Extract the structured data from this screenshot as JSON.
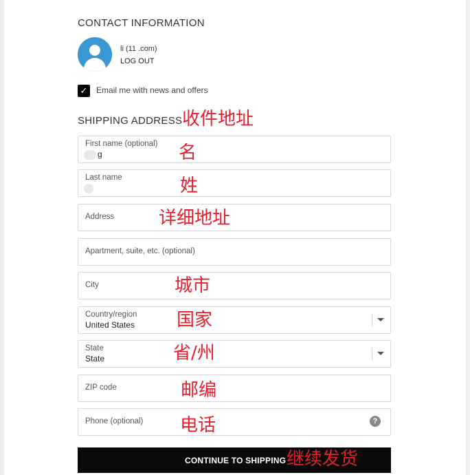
{
  "contact": {
    "title": "CONTACT INFORMATION",
    "user_email": "li (11 .com)",
    "logout_label": "LOG OUT",
    "newsletter_checked": true,
    "newsletter_label": "Email me with news and offers"
  },
  "shipping": {
    "title": "SHIPPING ADDRESS",
    "annotation": "收件地址",
    "fields": {
      "first_name": {
        "label": "First name (optional)",
        "value": "g",
        "annotation": "名"
      },
      "last_name": {
        "label": "Last name",
        "value": "",
        "annotation": "姓"
      },
      "address": {
        "label": "Address",
        "annotation": "详细地址"
      },
      "apartment": {
        "label": "Apartment, suite, etc. (optional)"
      },
      "city": {
        "label": "City",
        "annotation": "城市"
      },
      "country": {
        "label": "Country/region",
        "value": "United States",
        "annotation": "国家"
      },
      "state": {
        "label": "State",
        "value": "State",
        "annotation": "省/州"
      },
      "zip": {
        "label": "ZIP code",
        "annotation": "邮编"
      },
      "phone": {
        "label": "Phone (optional)",
        "annotation": "电话",
        "help_icon": "question-circle-icon",
        "help_glyph": "?"
      }
    }
  },
  "cta": {
    "label": "CONTINUE TO SHIPPING",
    "annotation": "继续发货"
  },
  "colors": {
    "accent": "#000000",
    "annotation": "#e4202e",
    "avatar": "#3b97d3"
  }
}
